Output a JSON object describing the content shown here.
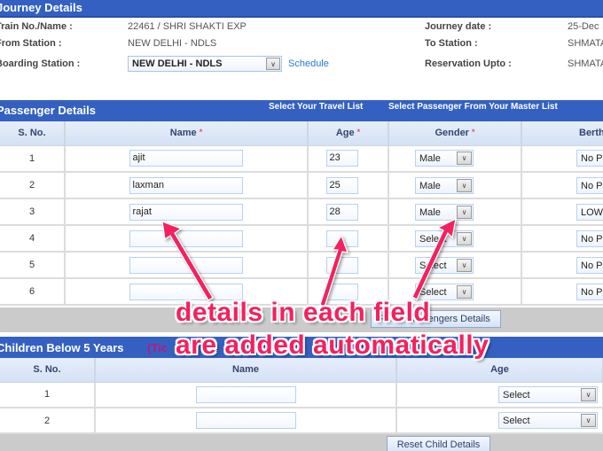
{
  "journey": {
    "title": "Journey Details",
    "train_label": "Train No./Name :",
    "train_value": "22461 / SHRI SHAKTI EXP",
    "from_label": "From Station :",
    "from_value": "NEW DELHI - NDLS",
    "boarding_label": "Boarding Station :",
    "boarding_value": "NEW DELHI - NDLS",
    "schedule_link": "Schedule",
    "date_label": "Journey date :",
    "date_value": "25-Dec",
    "to_label": "To Station :",
    "to_value": "SHMATA",
    "upto_label": "Reservation Upto :",
    "upto_value": "SHMATA"
  },
  "passengers": {
    "title": "Passenger Details",
    "travel_list_link": "Select Your Travel List",
    "master_list_link": "Select Passenger From Your Master List",
    "required_mark": "*",
    "columns": {
      "sno": "S. No.",
      "name": "Name",
      "age": "Age",
      "gender": "Gender",
      "berth": "Berth"
    },
    "rows": [
      {
        "sno": "1",
        "name": "ajit",
        "age": "23",
        "gender": "Male",
        "berth": "No Pr"
      },
      {
        "sno": "2",
        "name": "laxman",
        "age": "25",
        "gender": "Male",
        "berth": "No Pr"
      },
      {
        "sno": "3",
        "name": "rajat",
        "age": "28",
        "gender": "Male",
        "berth": "LOW"
      },
      {
        "sno": "4",
        "name": "",
        "age": "",
        "gender": "Select",
        "berth": "No Pr"
      },
      {
        "sno": "5",
        "name": "",
        "age": "",
        "gender": "Select",
        "berth": "No Pr"
      },
      {
        "sno": "6",
        "name": "",
        "age": "",
        "gender": "Select",
        "berth": "No Pr"
      }
    ],
    "reset_button": "Reset Passengers Details"
  },
  "children": {
    "title": "Children Below 5 Years",
    "tick_note": "(Tic",
    "columns": {
      "sno": "S. No.",
      "name": "Name",
      "age": "Age"
    },
    "rows": [
      {
        "sno": "1",
        "name": "",
        "age": "Select"
      },
      {
        "sno": "2",
        "name": "",
        "age": "Select"
      }
    ],
    "reset_button": "Reset Child Details"
  },
  "annotation": {
    "line1": "details in each field",
    "line2": "are added automatically",
    "color": "#f2215f"
  },
  "colors": {
    "header_bar": "#3461c1",
    "link": "#2a7ad8",
    "required": "#e64f7a"
  }
}
